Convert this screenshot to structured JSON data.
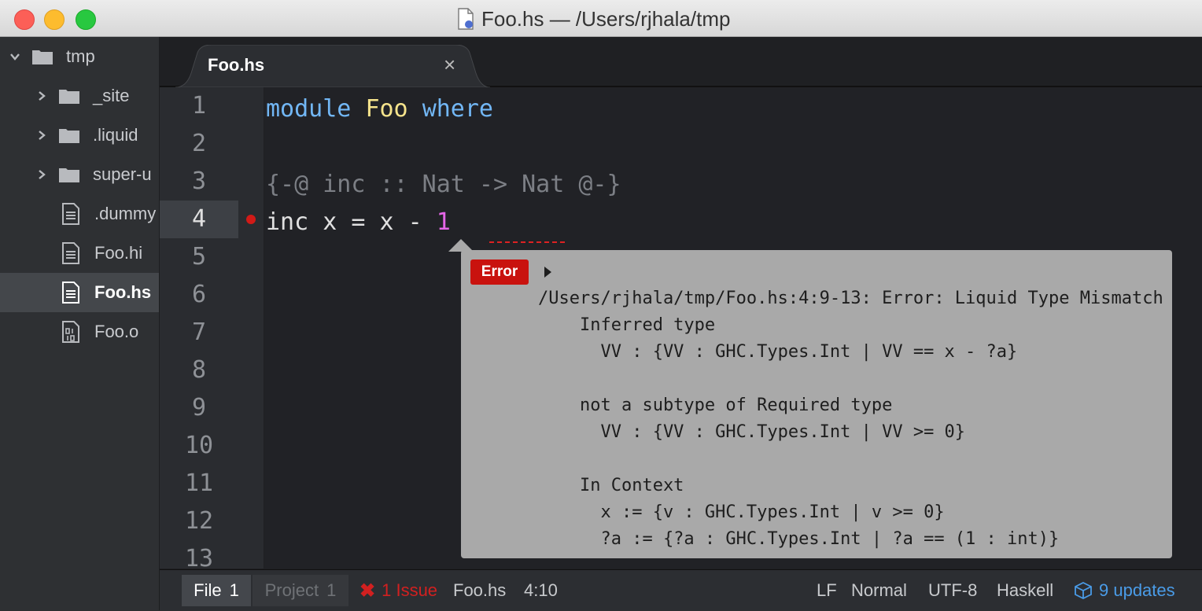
{
  "window": {
    "title": "Foo.hs — /Users/rjhala/tmp"
  },
  "tree": {
    "root": "tmp",
    "items": [
      {
        "label": "_site",
        "type": "folder"
      },
      {
        "label": ".liquid",
        "type": "folder"
      },
      {
        "label": "super-u",
        "type": "folder"
      },
      {
        "label": ".dummy",
        "type": "file"
      },
      {
        "label": "Foo.hi",
        "type": "file"
      },
      {
        "label": "Foo.hs",
        "type": "file",
        "selected": true
      },
      {
        "label": "Foo.o",
        "type": "binary"
      }
    ]
  },
  "tabs": [
    {
      "label": "Foo.hs",
      "close": "×"
    }
  ],
  "editor": {
    "line_numbers": [
      "1",
      "2",
      "3",
      "4",
      "5",
      "6",
      "7",
      "8",
      "9",
      "10",
      "11",
      "12",
      "13"
    ],
    "active_line": 4,
    "line1": {
      "kw1": "module",
      "name": "Foo",
      "kw2": "where"
    },
    "line3": {
      "comment": "{-@ inc :: Nat -> Nat @-}"
    },
    "line4": {
      "code": "inc x = x - ",
      "num": "1"
    }
  },
  "error_popup": {
    "badge": "Error",
    "lines": [
      "/Users/rjhala/tmp/Foo.hs:4:9-13: Error: Liquid Type Mismatch",
      "    Inferred type",
      "      VV : {VV : GHC.Types.Int | VV == x - ?a}",
      "",
      "    not a subtype of Required type",
      "      VV : {VV : GHC.Types.Int | VV >= 0}",
      "",
      "    In Context",
      "      x := {v : GHC.Types.Int | v >= 0}",
      "      ?a := {?a : GHC.Types.Int | ?a == (1 : int)}"
    ]
  },
  "statusbar": {
    "file_label": "File",
    "file_count": "1",
    "project_label": "Project",
    "project_count": "1",
    "issue_icon": "✖",
    "issues": "1 Issue",
    "filename": "Foo.hs",
    "cursor": "4:10",
    "line_ending": "LF",
    "mode": "Normal",
    "encoding": "UTF-8",
    "grammar": "Haskell",
    "updates": "9 updates"
  },
  "colors": {
    "error": "#c9120e",
    "keyword": "#72b7f5",
    "type": "#f6e48c",
    "number": "#e566e8",
    "link": "#4a9ce8"
  }
}
